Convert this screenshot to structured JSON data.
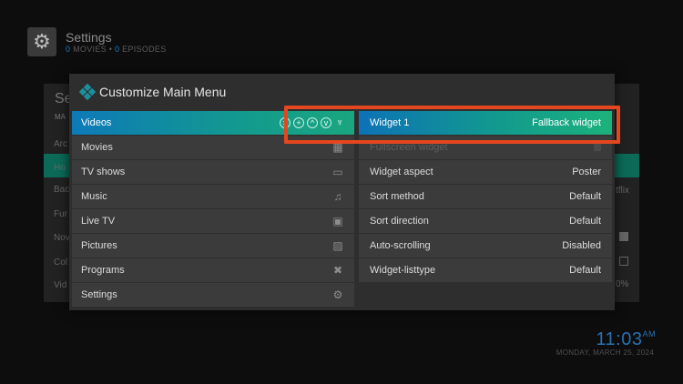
{
  "background": {
    "title": "Settings",
    "sub_movies_count": "0",
    "sub_movies_label": "MOVIES",
    "sub_episodes_count": "0",
    "sub_episodes_label": "EPISODES",
    "heading": "Se",
    "heading_small": "MA",
    "list": [
      "Arc",
      "Ho",
      "Bac",
      "Fur",
      "Nov",
      "Col",
      "Vid"
    ],
    "right_text_1": "tflix",
    "right_text_2": "0%"
  },
  "clock": {
    "time": "11:03",
    "ampm": "AM",
    "date": "MONDAY, MARCH 25, 2024"
  },
  "dialog": {
    "title": "Customize Main Menu",
    "menu": [
      {
        "label": "Videos",
        "icon": "controls"
      },
      {
        "label": "Movies",
        "icon": "film-icon"
      },
      {
        "label": "TV shows",
        "icon": "tv-icon"
      },
      {
        "label": "Music",
        "icon": "music-note-icon"
      },
      {
        "label": "Live TV",
        "icon": "live-tv-icon"
      },
      {
        "label": "Pictures",
        "icon": "picture-icon"
      },
      {
        "label": "Programs",
        "icon": "tools-icon"
      },
      {
        "label": "Settings",
        "icon": "gear-icon"
      }
    ],
    "options": [
      {
        "label": "Widget 1",
        "value": "Fallback widget"
      },
      {
        "label": "Fullscreen widget",
        "value": ""
      },
      {
        "label": "Widget aspect",
        "value": "Poster"
      },
      {
        "label": "Sort method",
        "value": "Default"
      },
      {
        "label": "Sort direction",
        "value": "Default"
      },
      {
        "label": "Auto-scrolling",
        "value": "Disabled"
      },
      {
        "label": "Widget-listtype",
        "value": "Default"
      }
    ]
  },
  "colors": {
    "accent_blue": "#0d7ab8",
    "accent_green": "#1aa680",
    "highlight": "#e4471f"
  }
}
